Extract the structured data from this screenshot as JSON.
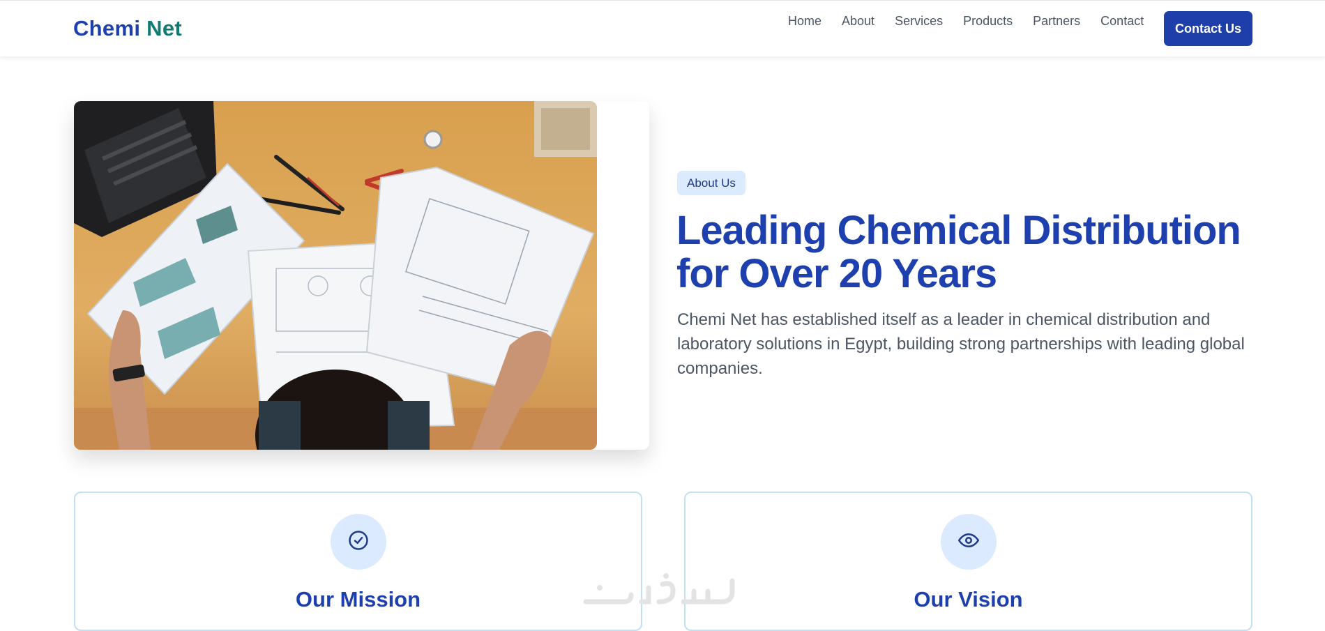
{
  "nav": {
    "brand_part1": "Chemi",
    "brand_part2": "Net",
    "links": [
      "Home",
      "About",
      "Services",
      "Products",
      "Partners",
      "Contact"
    ],
    "cta_label": "Contact Us"
  },
  "hero": {
    "tag": "About Us",
    "headline_line1": "Leading Chemical Distribution",
    "headline_line2": "for Over 20 Years",
    "description": "Chemi Net has established itself as a leader in chemical distribution and laboratory solutions in Egypt, building strong partnerships with leading global companies.",
    "image": "photo-of-person-reviewing-technical-drawings-on-desk"
  },
  "cards": [
    {
      "title": "Our Mission",
      "icon": "check-circle-icon"
    },
    {
      "title": "Our Vision",
      "icon": "eye-icon"
    }
  ],
  "watermark": "خمسات",
  "colors": {
    "primary": "#1e40af",
    "brand_accent": "#0f7d74",
    "button": "#1e3faa",
    "tag_bg": "#dbeafe",
    "card_border": "#bfe0f5"
  }
}
